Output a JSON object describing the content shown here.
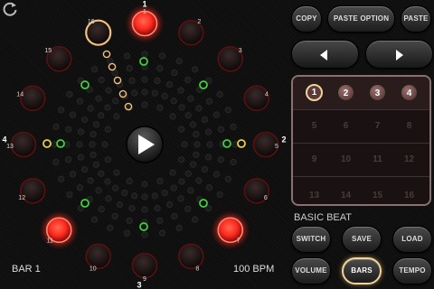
{
  "steps": [
    {
      "num": "1",
      "state": "on"
    },
    {
      "num": "2",
      "state": "off"
    },
    {
      "num": "3",
      "state": "off"
    },
    {
      "num": "4",
      "state": "off"
    },
    {
      "num": "5",
      "state": "off"
    },
    {
      "num": "6",
      "state": "off"
    },
    {
      "num": "7",
      "state": "on"
    },
    {
      "num": "8",
      "state": "off"
    },
    {
      "num": "9",
      "state": "off"
    },
    {
      "num": "10",
      "state": "off"
    },
    {
      "num": "11",
      "state": "on"
    },
    {
      "num": "12",
      "state": "off"
    },
    {
      "num": "13",
      "state": "off"
    },
    {
      "num": "14",
      "state": "off"
    },
    {
      "num": "15",
      "state": "off"
    },
    {
      "num": "16",
      "state": "playhead"
    }
  ],
  "beat_markers": {
    "top": "1",
    "right": "2",
    "bottom": "3",
    "left": "4"
  },
  "play_icon": "play-icon",
  "refresh_icon": "refresh-icon",
  "status": {
    "bar": "BAR 1",
    "bpm": "100 BPM"
  },
  "buttons": {
    "copy": "COPY",
    "paste_option": "PASTE OPTION",
    "paste": "PASTE",
    "switch": "SWITCH",
    "save": "SAVE",
    "load": "LOAD",
    "volume": "VOLUME",
    "bars": "BARS",
    "tempo": "TEMPO"
  },
  "pattern_name": "BASIC BEAT",
  "bars": [
    {
      "label": "1",
      "state": "current"
    },
    {
      "label": "2",
      "state": "active"
    },
    {
      "label": "3",
      "state": "active"
    },
    {
      "label": "4",
      "state": "active"
    },
    {
      "label": "5",
      "state": "inactive"
    },
    {
      "label": "6",
      "state": "inactive"
    },
    {
      "label": "7",
      "state": "inactive"
    },
    {
      "label": "8",
      "state": "inactive"
    },
    {
      "label": "9",
      "state": "inactive"
    },
    {
      "label": "10",
      "state": "inactive"
    },
    {
      "label": "11",
      "state": "inactive"
    },
    {
      "label": "12",
      "state": "inactive"
    },
    {
      "label": "13",
      "state": "inactive"
    },
    {
      "label": "14",
      "state": "inactive"
    },
    {
      "label": "15",
      "state": "inactive"
    },
    {
      "label": "16",
      "state": "inactive"
    }
  ],
  "colors": {
    "step_on": "#ff2a20",
    "playhead": "#f0c080",
    "green_ring": "#3fcf3f",
    "yellow_ring": "#e6d04a",
    "accent": "#f0d49a"
  }
}
